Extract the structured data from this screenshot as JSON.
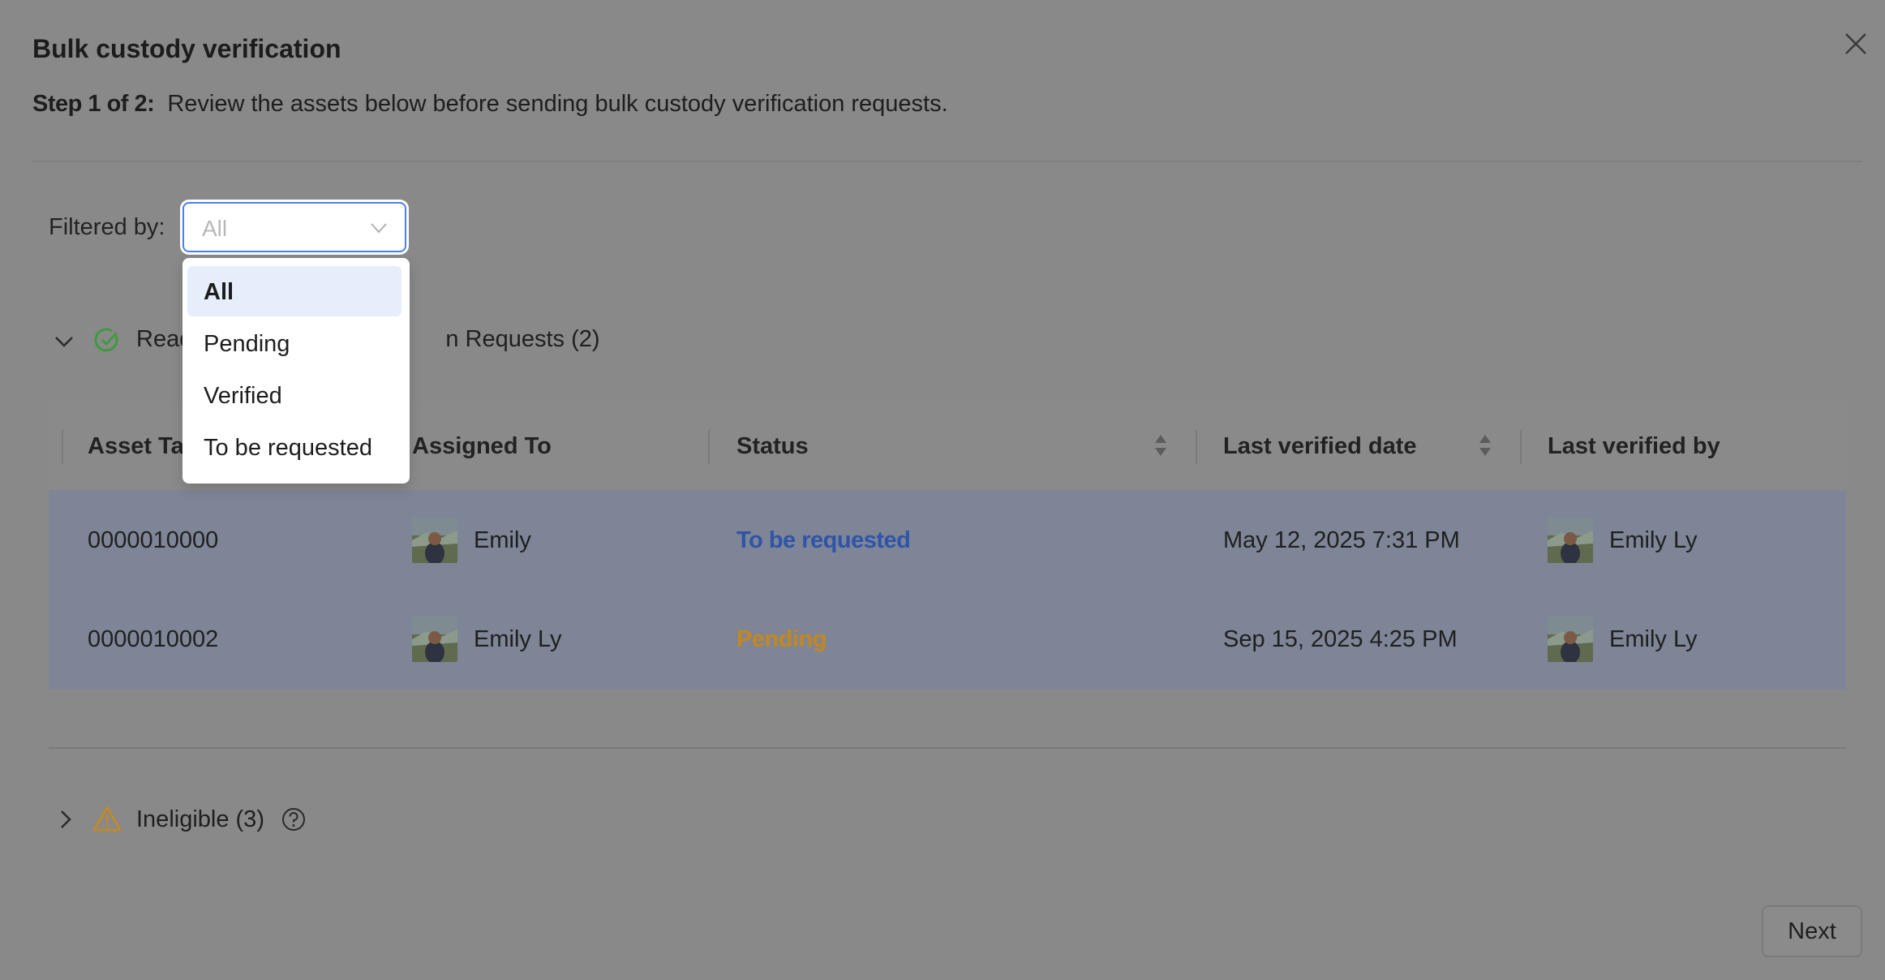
{
  "dialog": {
    "title": "Bulk custody verification",
    "step_label": "Step 1 of 2:",
    "step_text": "Review the assets below before sending bulk custody verification requests."
  },
  "filter": {
    "label": "Filtered by:",
    "selected": "All",
    "options": [
      "All",
      "Pending",
      "Verified",
      "To be requested"
    ]
  },
  "sections": {
    "ready_partial_prefix": "Read",
    "ready_partial_suffix": "n Requests (2)",
    "ineligible": "Ineligible (3)"
  },
  "table": {
    "columns": [
      "Asset Ta",
      "Assigned To",
      "Status",
      "Last verified date",
      "Last verified by"
    ],
    "rows": [
      {
        "asset_tag": "0000010000",
        "assigned_to": "Emily",
        "status": "To be requested",
        "last_verified_date": "May 12, 2025 7:31 PM",
        "last_verified_by": "Emily Ly"
      },
      {
        "asset_tag": "0000010002",
        "assigned_to": "Emily Ly",
        "status": "Pending",
        "last_verified_date": "Sep 15, 2025 4:25 PM",
        "last_verified_by": "Emily Ly"
      }
    ]
  },
  "footer": {
    "next_label": "Next"
  },
  "colors": {
    "overlay": "#898989",
    "accent": "#4a80e8",
    "status_to_be_requested": "#2f54a8",
    "status_pending": "#c4871f",
    "success": "#3f9a3f",
    "warning": "#c68a1e"
  }
}
